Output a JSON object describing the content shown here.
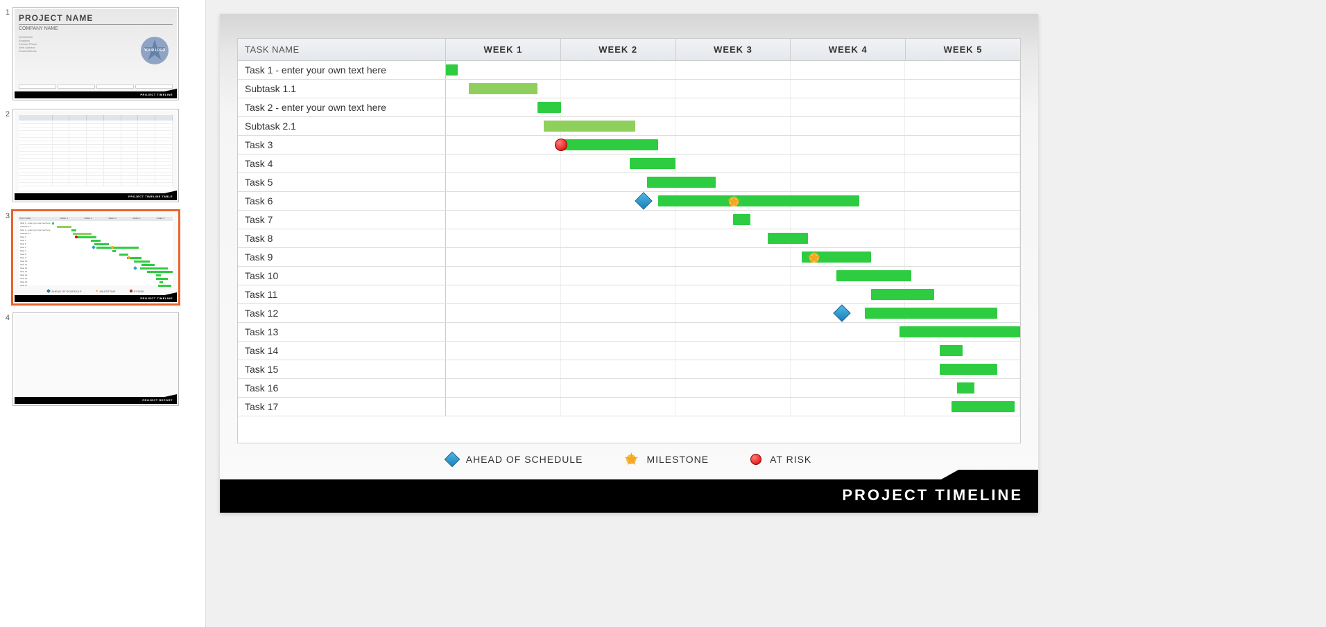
{
  "slides": {
    "s1": {
      "title": "PROJECT NAME",
      "subtitle": "COMPANY NAME",
      "footer": "PROJECT TIMELINE",
      "logo_text": "YOUR LOGO"
    },
    "s2": {
      "footer": "PROJECT TIMELINE TABLE"
    },
    "s3": {
      "footer": "PROJECT TIMELINE"
    },
    "s4": {
      "footer": "PROJECT REPORT"
    }
  },
  "main": {
    "header": {
      "task_col": "TASK NAME",
      "weeks": [
        "WEEK 1",
        "WEEK 2",
        "WEEK 3",
        "WEEK 4",
        "WEEK 5"
      ]
    },
    "legend": {
      "ahead": "AHEAD OF SCHEDULE",
      "milestone": "MILESTONE",
      "at_risk": "AT RISK"
    },
    "footer": "PROJECT TIMELINE"
  },
  "chart_data": {
    "type": "gantt",
    "title": "PROJECT TIMELINE",
    "x_unit": "week",
    "xlim": [
      0,
      5
    ],
    "columns": [
      "WEEK 1",
      "WEEK 2",
      "WEEK 3",
      "WEEK 4",
      "WEEK 5"
    ],
    "legend": [
      {
        "name": "AHEAD OF SCHEDULE",
        "marker": "diamond",
        "color": "#2a9fd6"
      },
      {
        "name": "MILESTONE",
        "marker": "sun",
        "color": "#f5a623"
      },
      {
        "name": "AT RISK",
        "marker": "red-dot",
        "color": "#d90000"
      }
    ],
    "tasks": [
      {
        "name": "Task 1 - enter your own text here",
        "start": 0.0,
        "end": 0.1,
        "status": "complete",
        "markers": []
      },
      {
        "name": "Subtask 1.1",
        "start": 0.2,
        "end": 0.8,
        "status": "in_progress",
        "markers": []
      },
      {
        "name": "Task 2 - enter your own text here",
        "start": 0.8,
        "end": 1.0,
        "status": "complete",
        "markers": []
      },
      {
        "name": "Subtask 2.1",
        "start": 0.85,
        "end": 1.65,
        "status": "in_progress",
        "markers": []
      },
      {
        "name": "Task 3",
        "start": 1.0,
        "end": 1.85,
        "status": "complete",
        "markers": [
          {
            "type": "at_risk",
            "x": 1.0
          }
        ]
      },
      {
        "name": "Task 4",
        "start": 1.6,
        "end": 2.0,
        "status": "complete",
        "markers": []
      },
      {
        "name": "Task 5",
        "start": 1.75,
        "end": 2.35,
        "status": "complete",
        "markers": []
      },
      {
        "name": "Task 6",
        "start": 1.85,
        "end": 3.6,
        "status": "complete",
        "markers": [
          {
            "type": "ahead",
            "x": 1.72
          },
          {
            "type": "milestone",
            "x": 2.5
          }
        ]
      },
      {
        "name": "Task 7",
        "start": 2.5,
        "end": 2.65,
        "status": "complete",
        "markers": []
      },
      {
        "name": "Task 8",
        "start": 2.8,
        "end": 3.15,
        "status": "complete",
        "markers": []
      },
      {
        "name": "Task 9",
        "start": 3.1,
        "end": 3.7,
        "status": "complete",
        "markers": [
          {
            "type": "milestone",
            "x": 3.2
          }
        ]
      },
      {
        "name": "Task 10",
        "start": 3.4,
        "end": 4.05,
        "status": "complete",
        "markers": []
      },
      {
        "name": "Task 11",
        "start": 3.7,
        "end": 4.25,
        "status": "complete",
        "markers": []
      },
      {
        "name": "Task 12",
        "start": 3.65,
        "end": 4.8,
        "status": "complete",
        "markers": [
          {
            "type": "ahead",
            "x": 3.45
          }
        ]
      },
      {
        "name": "Task 13",
        "start": 3.95,
        "end": 5.0,
        "status": "complete",
        "markers": []
      },
      {
        "name": "Task 14",
        "start": 4.3,
        "end": 4.5,
        "status": "complete",
        "markers": []
      },
      {
        "name": "Task 15",
        "start": 4.3,
        "end": 4.8,
        "status": "complete",
        "markers": []
      },
      {
        "name": "Task 16",
        "start": 4.45,
        "end": 4.6,
        "status": "complete",
        "markers": []
      },
      {
        "name": "Task 17",
        "start": 4.4,
        "end": 4.95,
        "status": "complete",
        "markers": []
      }
    ]
  }
}
